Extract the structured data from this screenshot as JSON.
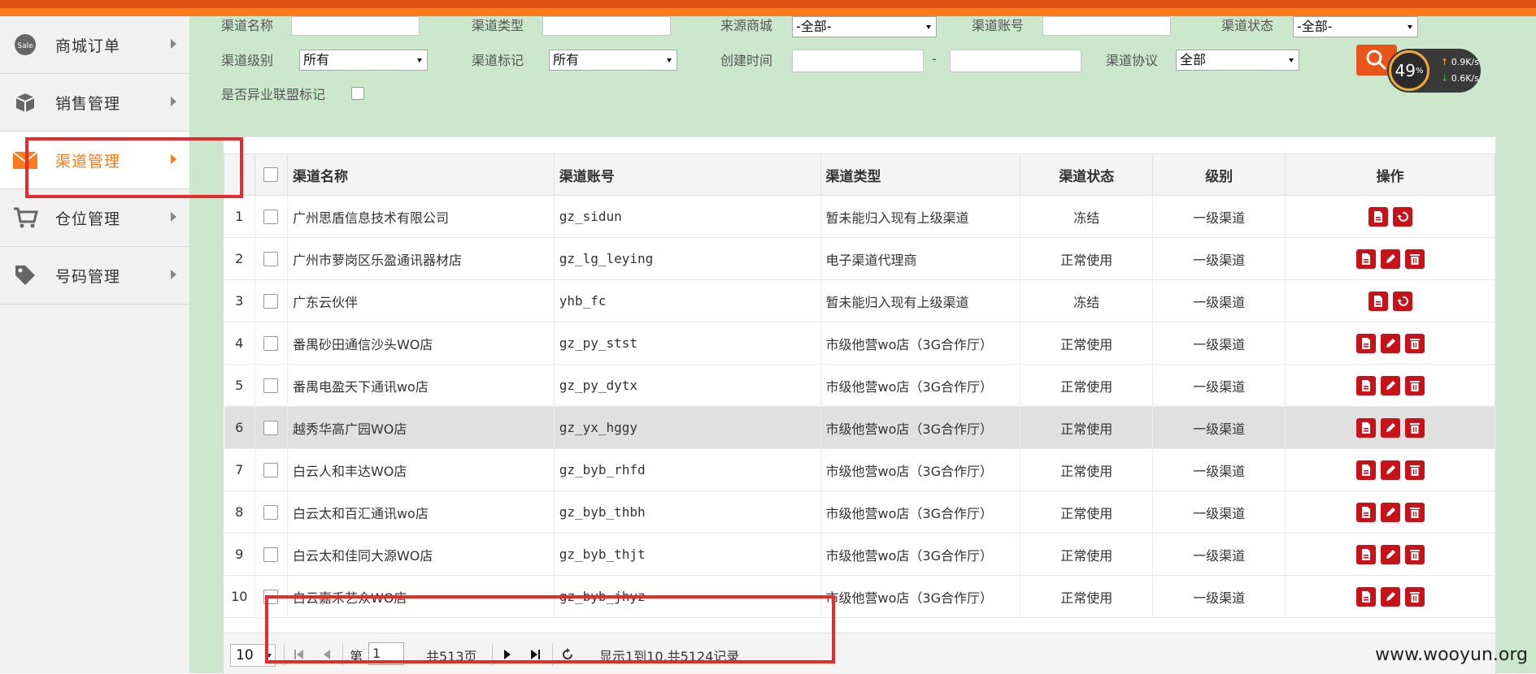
{
  "sidebar": {
    "items": [
      {
        "label": "商城订单",
        "icon": "sale-badge-icon"
      },
      {
        "label": "销售管理",
        "icon": "box-icon"
      },
      {
        "label": "渠道管理",
        "icon": "envelope-icon"
      },
      {
        "label": "仓位管理",
        "icon": "cart-icon"
      },
      {
        "label": "号码管理",
        "icon": "tag-icon"
      }
    ]
  },
  "filters": {
    "channel_name_label": "渠道名称",
    "channel_type_label": "渠道类型",
    "source_mall_label": "来源商城",
    "source_mall_value": "-全部-",
    "channel_account_label": "渠道账号",
    "channel_status_label": "渠道状态",
    "channel_status_value": "-全部-",
    "channel_level_label": "渠道级别",
    "channel_level_value": "所有",
    "channel_mark_label": "渠道标记",
    "channel_mark_value": "所有",
    "create_time_label": "创建时间",
    "create_time_sep": "-",
    "channel_protocol_label": "渠道协议",
    "channel_protocol_value": "全部",
    "cross_industry_label": "是否异业联盟标记"
  },
  "speed_widget": {
    "percent": "49",
    "unit": "%",
    "up": "0.9K/s",
    "down": "0.6K/s"
  },
  "table": {
    "headers": {
      "name": "渠道名称",
      "account": "渠道账号",
      "type": "渠道类型",
      "status": "渠道状态",
      "level": "级别",
      "actions": "操作"
    },
    "rows": [
      {
        "num": "1",
        "name": "广州思盾信息技术有限公司",
        "account": "gz_sidun",
        "type": "暂未能归入现有上级渠道",
        "status": "冻结",
        "level": "一级渠道",
        "actions": [
          "view",
          "restore"
        ]
      },
      {
        "num": "2",
        "name": "广州市萝岗区乐盈通讯器材店",
        "account": "gz_lg_leying",
        "type": "电子渠道代理商",
        "status": "正常使用",
        "level": "一级渠道",
        "actions": [
          "view",
          "edit",
          "delete"
        ]
      },
      {
        "num": "3",
        "name": "广东云伙伴",
        "account": "yhb_fc",
        "type": "暂未能归入现有上级渠道",
        "status": "冻结",
        "level": "一级渠道",
        "actions": [
          "view",
          "restore"
        ]
      },
      {
        "num": "4",
        "name": "番禺砂田通信沙头WO店",
        "account": "gz_py_stst",
        "type": "市级他营wo店（3G合作厅）",
        "status": "正常使用",
        "level": "一级渠道",
        "actions": [
          "view",
          "edit",
          "delete"
        ]
      },
      {
        "num": "5",
        "name": "番禺电盈天下通讯wo店",
        "account": "gz_py_dytx",
        "type": "市级他营wo店（3G合作厅）",
        "status": "正常使用",
        "level": "一级渠道",
        "actions": [
          "view",
          "edit",
          "delete"
        ]
      },
      {
        "num": "6",
        "name": "越秀华高广园WO店",
        "account": "gz_yx_hggy",
        "type": "市级他营wo店（3G合作厅）",
        "status": "正常使用",
        "level": "一级渠道",
        "actions": [
          "view",
          "edit",
          "delete"
        ]
      },
      {
        "num": "7",
        "name": "白云人和丰达WO店",
        "account": "gz_byb_rhfd",
        "type": "市级他营wo店（3G合作厅）",
        "status": "正常使用",
        "level": "一级渠道",
        "actions": [
          "view",
          "edit",
          "delete"
        ]
      },
      {
        "num": "8",
        "name": "白云太和百汇通讯wo店",
        "account": "gz_byb_thbh",
        "type": "市级他营wo店（3G合作厅）",
        "status": "正常使用",
        "level": "一级渠道",
        "actions": [
          "view",
          "edit",
          "delete"
        ]
      },
      {
        "num": "9",
        "name": "白云太和佳同大源WO店",
        "account": "gz_byb_thjt",
        "type": "市级他营wo店（3G合作厅）",
        "status": "正常使用",
        "level": "一级渠道",
        "actions": [
          "view",
          "edit",
          "delete"
        ]
      },
      {
        "num": "10",
        "name": "白云嘉禾艺众WO店",
        "account": "gz_byb_jhyz",
        "type": "市级他营wo店（3G合作厅）",
        "status": "正常使用",
        "level": "一级渠道",
        "actions": [
          "view",
          "edit",
          "delete"
        ]
      }
    ]
  },
  "pager": {
    "page_size": "10",
    "page_prefix": "第",
    "page_value": "1",
    "page_total": "共513页",
    "summary": "显示1到10,共5124记录"
  },
  "watermark": "www.wooyun.org",
  "colors": {
    "accent": "#ff7a1a",
    "main_bg": "#cbe8cd",
    "action_red": "#c8121a",
    "annotation_red": "#e82a2a"
  }
}
